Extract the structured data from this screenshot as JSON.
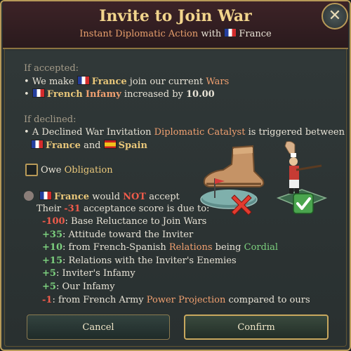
{
  "dialog": {
    "title": "Invite to Join War",
    "subtitle_prefix": "Instant Diplomatic Action",
    "subtitle_with": "with",
    "target_country": "France"
  },
  "if_accepted": {
    "header": "If accepted:",
    "line1": {
      "bullet": "•",
      "pre": "We make",
      "country": "France",
      "mid": "join our current",
      "link": "Wars"
    },
    "line2": {
      "bullet": "•",
      "country_adj": "French",
      "link": "Infamy",
      "mid": "increased by",
      "value": "10.00"
    }
  },
  "if_declined": {
    "header": "If declined:",
    "line1": {
      "bullet": "•",
      "pre": "A Declined War Invitation",
      "link": "Diplomatic Catalyst",
      "post": "is triggered between"
    },
    "line2": {
      "country_a": "France",
      "conj": "and",
      "country_b": "Spain"
    }
  },
  "obligation": {
    "pre": "Owe",
    "link": "Obligation",
    "checked": false
  },
  "acceptance": {
    "country": "France",
    "verdict_pre": "would",
    "verdict_neg": "NOT",
    "verdict_post": "accept",
    "score_pre": "Their",
    "score": "-31",
    "score_post": "acceptance score is due to:",
    "factors": [
      {
        "value": "-100",
        "color": "red",
        "parts": [
          {
            "t": ": Base Reluctance to Join Wars",
            "c": "w"
          }
        ]
      },
      {
        "value": "+35",
        "color": "green",
        "parts": [
          {
            "t": ": Attitude toward the Inviter",
            "c": "w"
          }
        ]
      },
      {
        "value": "+10",
        "color": "green",
        "parts": [
          {
            "t": ": from French-Spanish ",
            "c": "w"
          },
          {
            "t": "Relations",
            "c": "o"
          },
          {
            "t": " being ",
            "c": "w"
          },
          {
            "t": "Cordial",
            "c": "g"
          }
        ]
      },
      {
        "value": "+15",
        "color": "green",
        "parts": [
          {
            "t": ": Relations with the Inviter's Enemies",
            "c": "w"
          }
        ]
      },
      {
        "value": "+5",
        "color": "green",
        "parts": [
          {
            "t": ": Inviter's Infamy",
            "c": "w"
          }
        ]
      },
      {
        "value": "+5",
        "color": "green",
        "parts": [
          {
            "t": ": Our Infamy",
            "c": "w"
          }
        ]
      },
      {
        "value": "-1",
        "color": "red",
        "parts": [
          {
            "t": ": from French Army ",
            "c": "w"
          },
          {
            "t": "Power Projection",
            "c": "o"
          },
          {
            "t": " compared to ours",
            "c": "w"
          }
        ]
      }
    ]
  },
  "buttons": {
    "cancel": "Cancel",
    "confirm": "Confirm"
  },
  "icons": {
    "close": "close-icon",
    "flag_france": "france-flag-icon",
    "flag_spain": "spain-flag-icon",
    "boot": "boot-icon",
    "soldier": "soldier-icon",
    "cross": "red-cross-icon",
    "check": "green-check-icon",
    "unhappy": "unhappy-face-icon"
  },
  "colors": {
    "gold": "#f1d48c",
    "orange": "#f0a070",
    "green": "#7cd07e",
    "red": "#ef5b4b",
    "confirm_border": "#c8a85e"
  }
}
